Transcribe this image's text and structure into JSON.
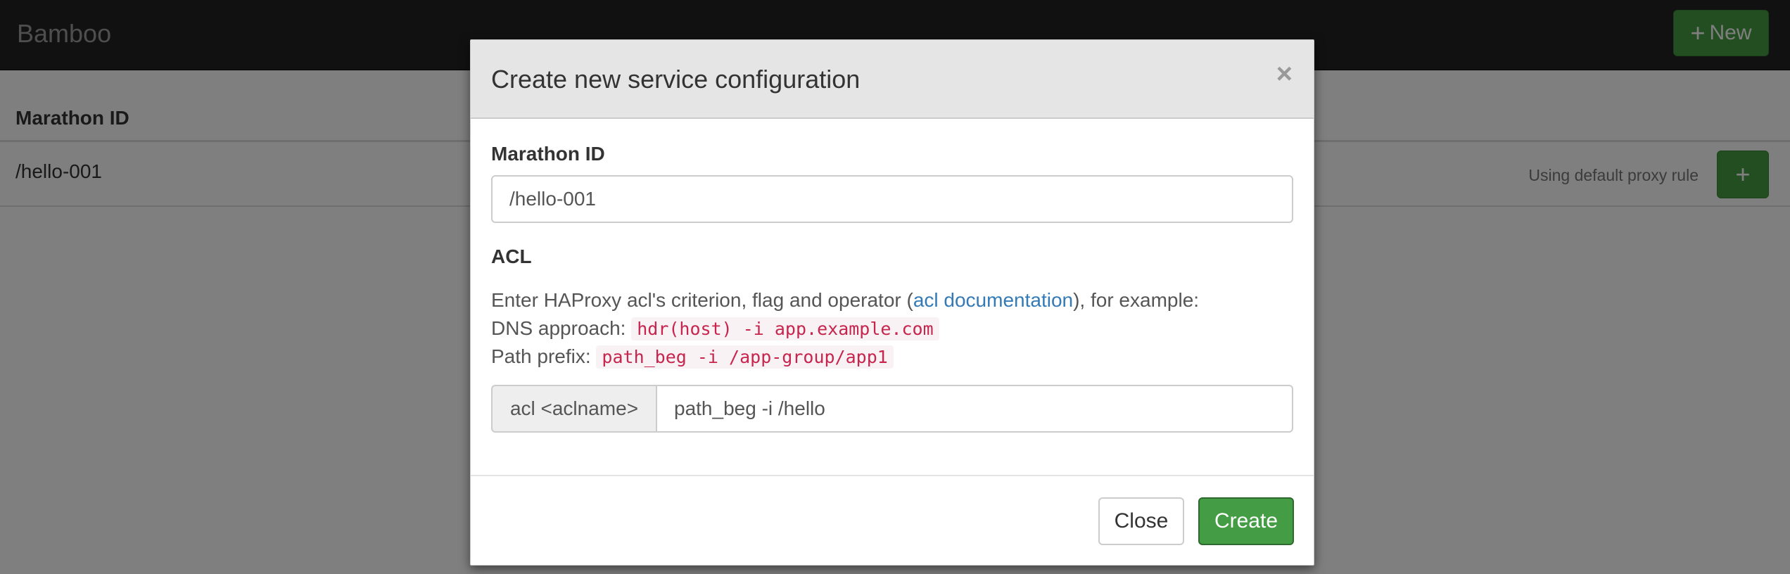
{
  "navbar": {
    "brand": "Bamboo",
    "new_button": {
      "icon": "plus-icon",
      "glyph": "+",
      "label": "New"
    }
  },
  "table": {
    "header": {
      "marathon_id": "Marathon ID"
    },
    "rows": [
      {
        "id": "/hello-001",
        "status": "Using default proxy rule",
        "add_glyph": "+"
      }
    ]
  },
  "modal": {
    "title": "Create new service configuration",
    "close_glyph": "×",
    "marathon_id_label": "Marathon ID",
    "marathon_id_value": "/hello-001",
    "acl_label": "ACL",
    "help": {
      "intro_before": "Enter HAProxy acl's criterion, flag and operator (",
      "link_text": "acl documentation",
      "intro_after": "), for example:",
      "dns_label": "DNS approach:",
      "dns_code": "hdr(host) -i app.example.com",
      "path_label": "Path prefix:",
      "path_code": "path_beg -i /app-group/app1"
    },
    "acl_addon": "acl <aclname>",
    "acl_value": "path_beg -i /hello",
    "buttons": {
      "close": "Close",
      "create": "Create"
    }
  },
  "colors": {
    "navbar": "#222222",
    "primary_green": "#449d44",
    "link": "#337ab7",
    "code": "#c7254e"
  }
}
